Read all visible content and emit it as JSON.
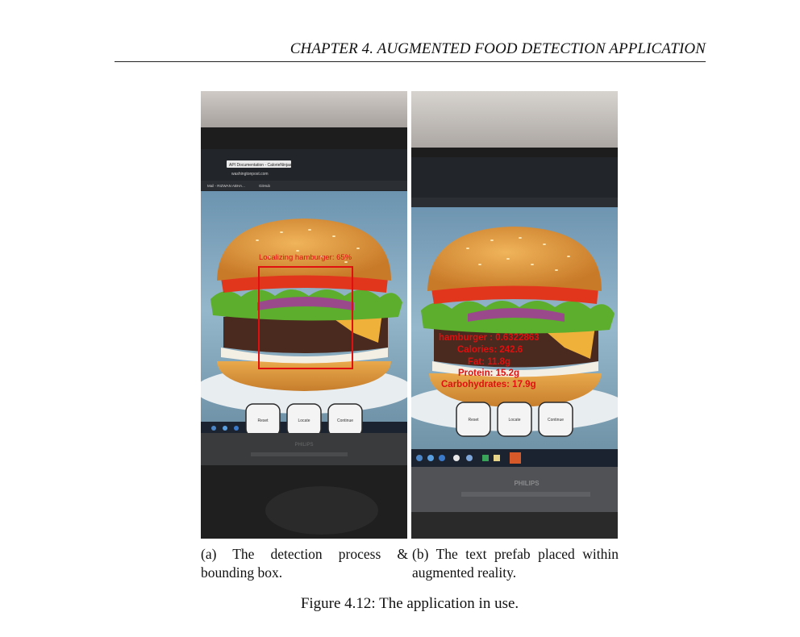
{
  "header": {
    "chapter_title": "CHAPTER 4.  AUGMENTED FOOD DETECTION APPLICATION"
  },
  "panel_a": {
    "localizing_label": "Localizing hamburger: 65%",
    "buttons": [
      "Reset",
      "Locate",
      "Continue"
    ],
    "browser_tab": "API Documentation - CalorieNinjas",
    "address": "washingtonpost.com",
    "bookmark_mail": "Mail - RIZWAN ABHA...",
    "bookmarks": "GitHub",
    "monitor_brand": "PHILIPS"
  },
  "panel_b": {
    "detection_lines": [
      "hamburger : 0.6322863",
      "Calories: 242.6",
      "Fat: 11.8g",
      "Protein: 15.2g",
      "Carbohydrates: 17.9g"
    ],
    "buttons": [
      "Reset",
      "Locate",
      "Continue"
    ],
    "monitor_brand": "PHILIPS"
  },
  "captions": {
    "a": "(a) The detection process & bounding box.",
    "b": "(b) The text prefab placed within augmented reality.",
    "figure": "Figure 4.12: The application in use."
  },
  "colors": {
    "detection_red": "#e01010",
    "bun": "#e19a3c",
    "lettuce": "#5cae2c",
    "patty": "#4a2a1e"
  }
}
